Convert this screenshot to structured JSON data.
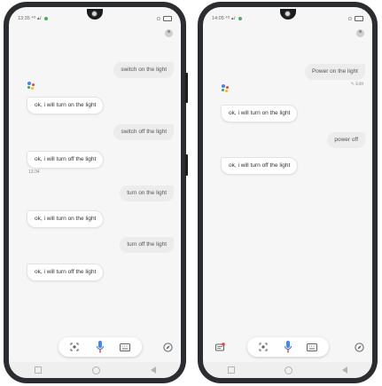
{
  "left_phone": {
    "status": {
      "time": "13:35",
      "signals": "⁴ᴳ ▴ⅈ",
      "right": "◘"
    },
    "messages": [
      {
        "role": "user",
        "text": "switch on the light"
      },
      {
        "role": "assistant",
        "text": "ok, i will turn on the light"
      },
      {
        "role": "user",
        "text": "switch off the light"
      },
      {
        "role": "assistant",
        "text": "ok, i will turn off the light"
      },
      {
        "role": "timestamp",
        "text": "13:34"
      },
      {
        "role": "user",
        "text": "turn on the light"
      },
      {
        "role": "assistant",
        "text": "ok, i will turn on the light"
      },
      {
        "role": "user",
        "text": "turn off the light"
      },
      {
        "role": "assistant",
        "text": "ok, i will turn off the light"
      }
    ],
    "toolbar_icons": [
      "lens-icon",
      "mic-icon",
      "keyboard-icon",
      "compass-icon"
    ]
  },
  "right_phone": {
    "status": {
      "time": "14:05",
      "signals": "⁴ᴳ ▴ⅈ",
      "right": "◘"
    },
    "messages": [
      {
        "role": "user",
        "text": "Power on the light"
      },
      {
        "role": "edit",
        "text": "Edit"
      },
      {
        "role": "assistant",
        "text": "ok, i will turn on the light"
      },
      {
        "role": "user",
        "text": "power off"
      },
      {
        "role": "assistant",
        "text": "ok, i will turn off the light"
      }
    ],
    "toolbar_icons": [
      "snapshot-icon",
      "lens-icon",
      "mic-icon",
      "keyboard-icon",
      "compass-icon"
    ]
  },
  "colors": {
    "phone_frame": "#2b2d30",
    "screen_bg": "#f6f6f6",
    "user_bubble": "#ececec",
    "assistant_bubble": "#ffffff",
    "mic_blue": "#4285f4",
    "mic_red": "#ea4335"
  }
}
